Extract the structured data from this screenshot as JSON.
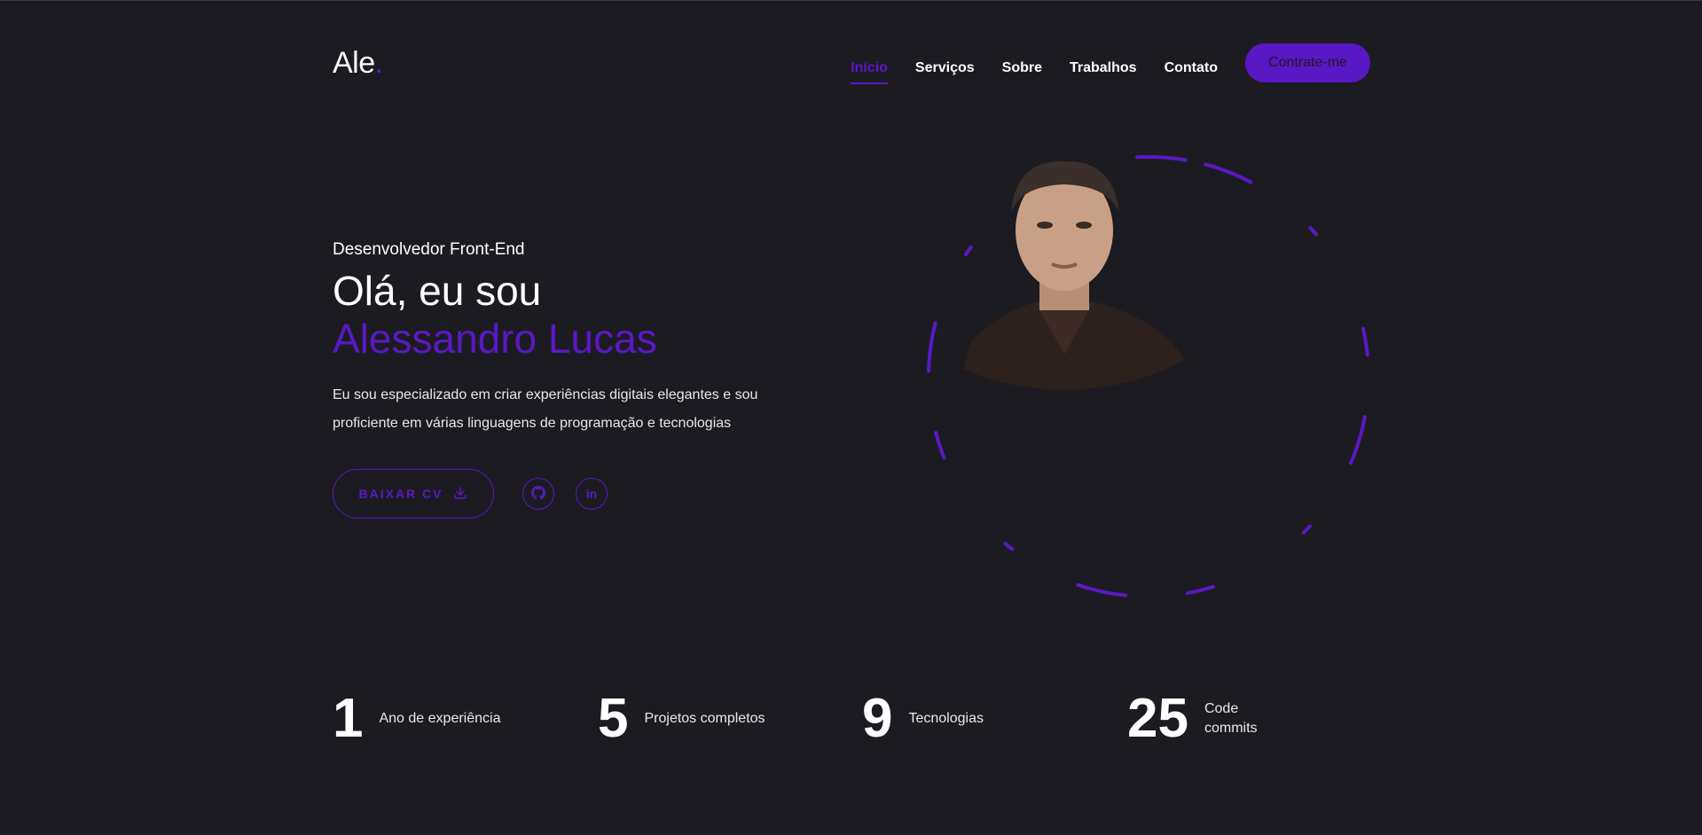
{
  "header": {
    "logo": "Ale",
    "logo_dot": ".",
    "nav": [
      {
        "label": "Início",
        "active": true
      },
      {
        "label": "Serviços",
        "active": false
      },
      {
        "label": "Sobre",
        "active": false
      },
      {
        "label": "Trabalhos",
        "active": false
      },
      {
        "label": "Contato",
        "active": false
      }
    ],
    "cta_label": "Contrate-me"
  },
  "hero": {
    "role": "Desenvolvedor Front-End",
    "greeting": "Olá, eu sou",
    "name": "Alessandro Lucas",
    "description": "Eu sou especializado em criar experiências digitais elegantes e sou proficiente em várias linguagens de programação e tecnologias",
    "cv_label": "BAIXAR CV",
    "socials": [
      {
        "icon": "github-icon"
      },
      {
        "icon": "linkedin-icon",
        "text": "in"
      }
    ]
  },
  "stats": [
    {
      "number": "1",
      "label": "Ano de experiência"
    },
    {
      "number": "5",
      "label": "Projetos completos"
    },
    {
      "number": "9",
      "label": "Tecnologias"
    },
    {
      "number": "25",
      "label_lines": [
        "Code",
        "commits"
      ]
    }
  ],
  "colors": {
    "background": "#1c1b22",
    "accent": "#5a18c4",
    "text": "#ffffff"
  }
}
